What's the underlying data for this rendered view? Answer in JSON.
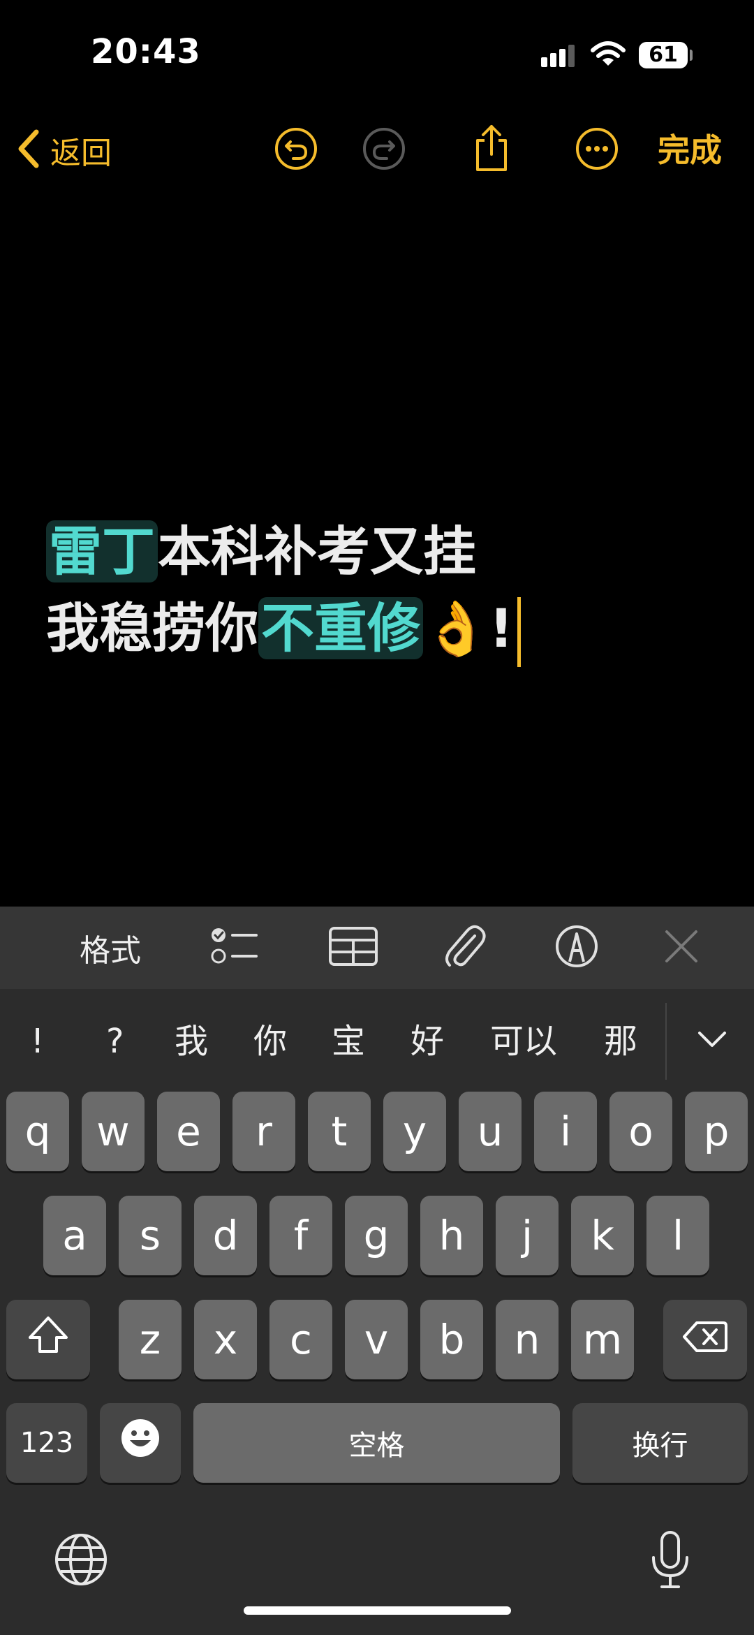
{
  "status_bar": {
    "time": "20:43",
    "battery": "61"
  },
  "toolbar": {
    "back_label": "返回",
    "done_label": "完成"
  },
  "note": {
    "line1_hl": "雷丁",
    "line1_rest": "本科补考又挂",
    "line2_start": "我稳捞你",
    "line2_hl": "不重修",
    "line2_emoji": "👌",
    "line2_end": "!"
  },
  "format_bar": {
    "format_label": "格式"
  },
  "keyboard": {
    "candidates": [
      "!",
      "?",
      "我",
      "你",
      "宝",
      "好",
      "可以",
      "那"
    ],
    "row1": [
      "q",
      "w",
      "e",
      "r",
      "t",
      "y",
      "u",
      "i",
      "o",
      "p"
    ],
    "row2": [
      "a",
      "s",
      "d",
      "f",
      "g",
      "h",
      "j",
      "k",
      "l"
    ],
    "row3": [
      "z",
      "x",
      "c",
      "v",
      "b",
      "n",
      "m"
    ],
    "numbers_label": "123",
    "space_label": "空格",
    "return_label": "换行"
  },
  "colors": {
    "accent": "#f5bc2c",
    "highlight_text": "#52d9cf",
    "highlight_bg": "#12302d"
  }
}
